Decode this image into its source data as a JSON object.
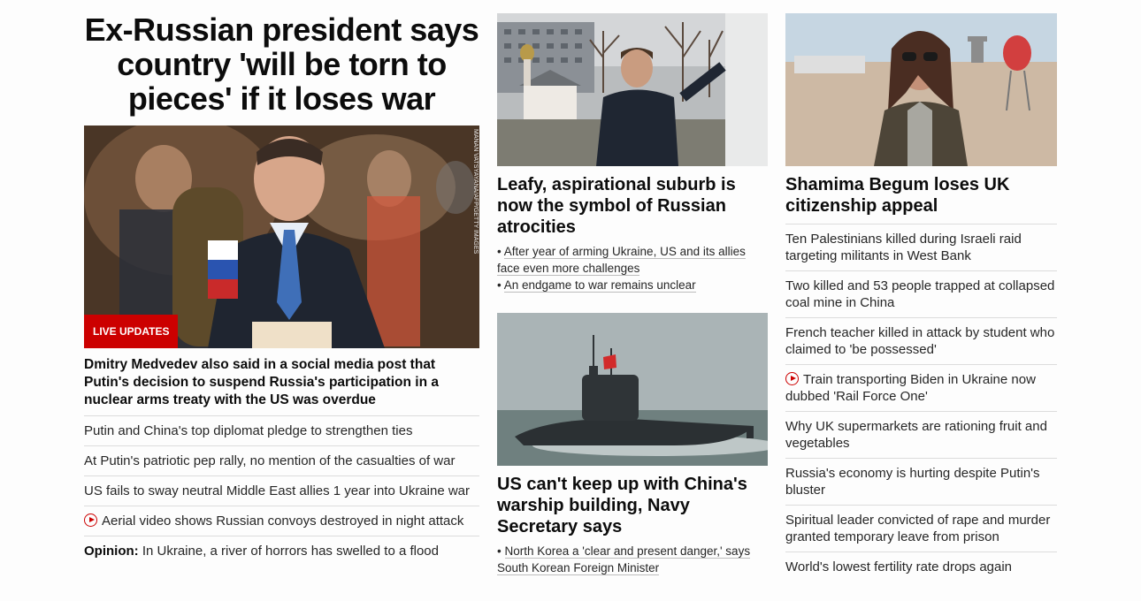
{
  "main": {
    "headline": "Ex-Russian president says country 'will be torn to pieces' if it loses war",
    "hero_credit": "MANAN VATSYAYANA/AFP/GETTY IMAGES",
    "hero_badge": "LIVE UPDATES",
    "lead": "Dmitry Medvedev also said in a social media post that Putin's decision to suspend Russia's participation in a nuclear arms treaty with the US was overdue",
    "links": [
      "Putin and China's top diplomat pledge to strengthen ties",
      "At Putin's patriotic pep rally, no mention of the casualties of war",
      "US fails to sway neutral Middle East allies 1 year into Ukraine war",
      "Aerial video shows Russian convoys destroyed in night attack"
    ],
    "opinion_label": "Opinion:",
    "opinion_text": "In Ukraine, a river of horrors has swelled to a flood"
  },
  "middle": {
    "card1": {
      "title": "Leafy, aspirational suburb is now the symbol of Russian atrocities",
      "subs": [
        "After year of arming Ukraine, US and its allies face even more challenges",
        "An endgame to war remains unclear"
      ]
    },
    "card2": {
      "title": "US can't keep up with China's warship building, Navy Secretary says",
      "subs": [
        "North Korea a 'clear and present danger,' says South Korean Foreign Minister"
      ]
    },
    "bullet": "•"
  },
  "right": {
    "title": "Shamima Begum loses UK citizenship appeal",
    "links": [
      "Ten Palestinians killed during Israeli raid targeting militants in West Bank",
      "Two killed and 53 people trapped at collapsed coal mine in China",
      "French teacher killed in attack by student who claimed to 'be possessed'",
      "Train transporting Biden in Ukraine now dubbed 'Rail Force One'",
      "Why UK supermarkets are rationing fruit and vegetables",
      "Russia's economy is hurting despite Putin's bluster",
      "Spiritual leader convicted of rape and murder granted temporary leave from prison",
      "World's lowest fertility rate drops again"
    ]
  },
  "colors": {
    "accent": "#cc0000",
    "text": "#0c0c0c",
    "divider": "#dcdcdc"
  },
  "icons": {
    "video": "play-circle-icon"
  }
}
